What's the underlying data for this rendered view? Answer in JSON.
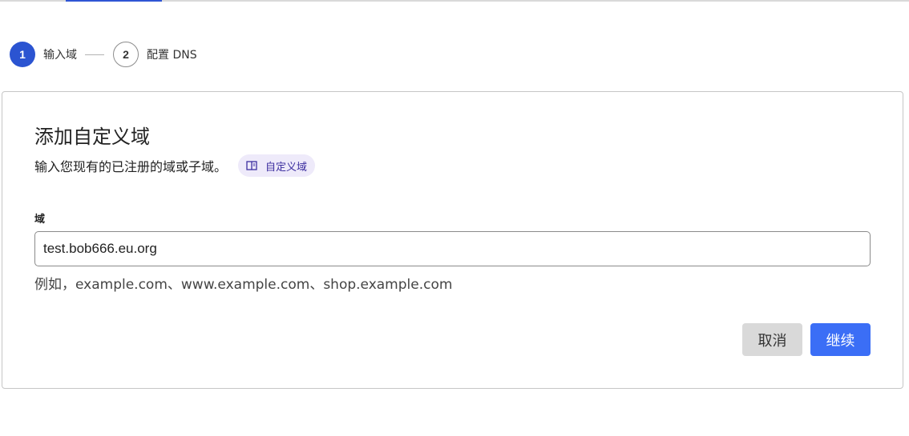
{
  "stepper": {
    "steps": [
      {
        "number": "1",
        "label": "输入域",
        "state": "active"
      },
      {
        "number": "2",
        "label": "配置 DNS",
        "state": "inactive"
      }
    ]
  },
  "card": {
    "title": "添加自定义域",
    "subtitle": "输入您现有的已注册的域或子域。",
    "doc_chip": {
      "label": "自定义域",
      "icon": "book-icon"
    },
    "field": {
      "label": "域",
      "value": "test.bob666.eu.org",
      "hint": "例如，example.com、www.example.com、shop.example.com"
    },
    "buttons": {
      "cancel": "取消",
      "continue": "继续"
    }
  },
  "colors": {
    "accent": "#2b54d1",
    "primary_button": "#3b6ef6",
    "chip_bg": "#eeeafa",
    "chip_text": "#3d2fa0"
  }
}
